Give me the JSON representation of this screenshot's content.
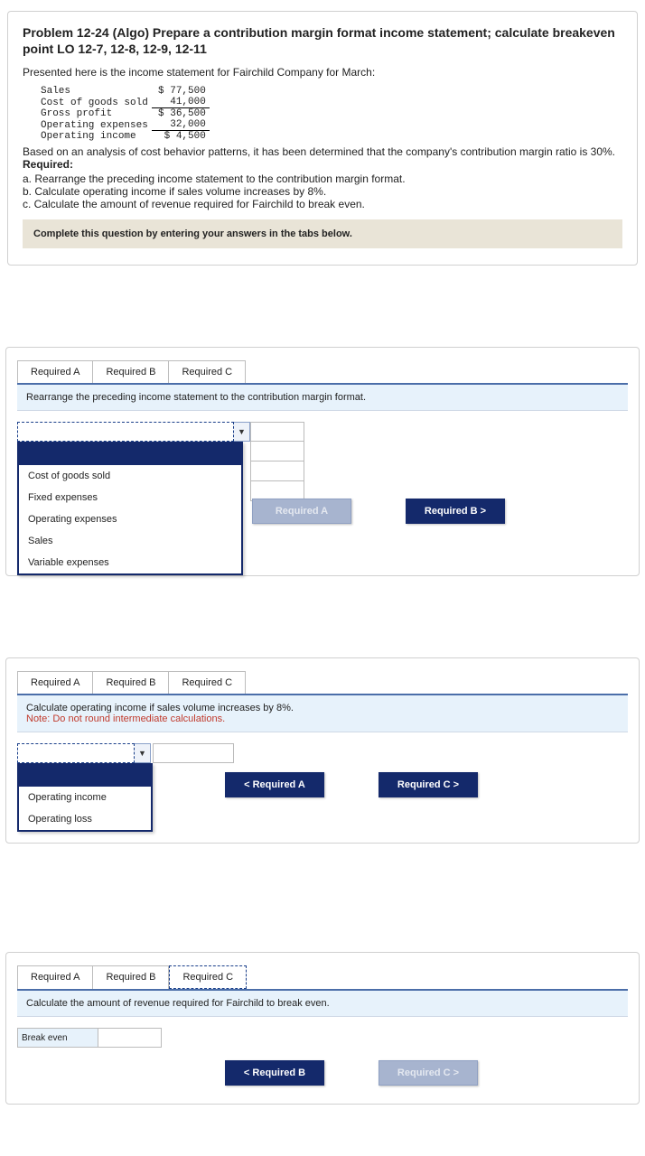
{
  "problem": {
    "title": "Problem 12-24 (Algo) Prepare a contribution margin format income statement; calculate breakeven point LO 12-7, 12-8, 12-9, 12-11",
    "intro": "Presented here is the income statement for Fairchild Company for March:",
    "income_statement": {
      "rows": [
        {
          "label": "Sales",
          "dollar": "$",
          "value": "77,500"
        },
        {
          "label": "Cost of goods sold",
          "dollar": "",
          "value": "41,000"
        },
        {
          "label": "Gross profit",
          "dollar": "$",
          "value": "36,500"
        },
        {
          "label": "Operating expenses",
          "dollar": "",
          "value": "32,000"
        },
        {
          "label": "Operating income",
          "dollar": "$",
          "value": "4,500"
        }
      ]
    },
    "analysis": "Based on an analysis of cost behavior patterns, it has been determined that the company's contribution margin ratio is 30%.",
    "required_label": "Required:",
    "required": {
      "a": "a. Rearrange the preceding income statement to the contribution margin format.",
      "b": "b. Calculate operating income if sales volume increases by 8%.",
      "c": "c. Calculate the amount of revenue required for Fairchild to break even."
    },
    "complete_banner": "Complete this question by entering your answers in the tabs below."
  },
  "tabs": {
    "a": "Required A",
    "b": "Required B",
    "c": "Required C"
  },
  "panelA": {
    "instruction": "Rearrange the preceding income statement to the contribution margin format.",
    "dropdown": [
      "Cost of goods sold",
      "Fixed expenses",
      "Operating expenses",
      "Sales",
      "Variable expenses"
    ],
    "nav_prev": "Required A",
    "nav_next": "Required B  >"
  },
  "panelB": {
    "instruction": "Calculate operating income if sales volume increases by 8%.",
    "note": "Note: Do not round intermediate calculations.",
    "dropdown": [
      "Operating income",
      "Operating loss"
    ],
    "nav_prev": "<   Required A",
    "nav_next": "Required C   >"
  },
  "panelC": {
    "instruction": "Calculate the amount of revenue required for Fairchild to break even.",
    "row_label": "Break even",
    "nav_prev": "<   Required B",
    "nav_next": "Required C   >"
  }
}
